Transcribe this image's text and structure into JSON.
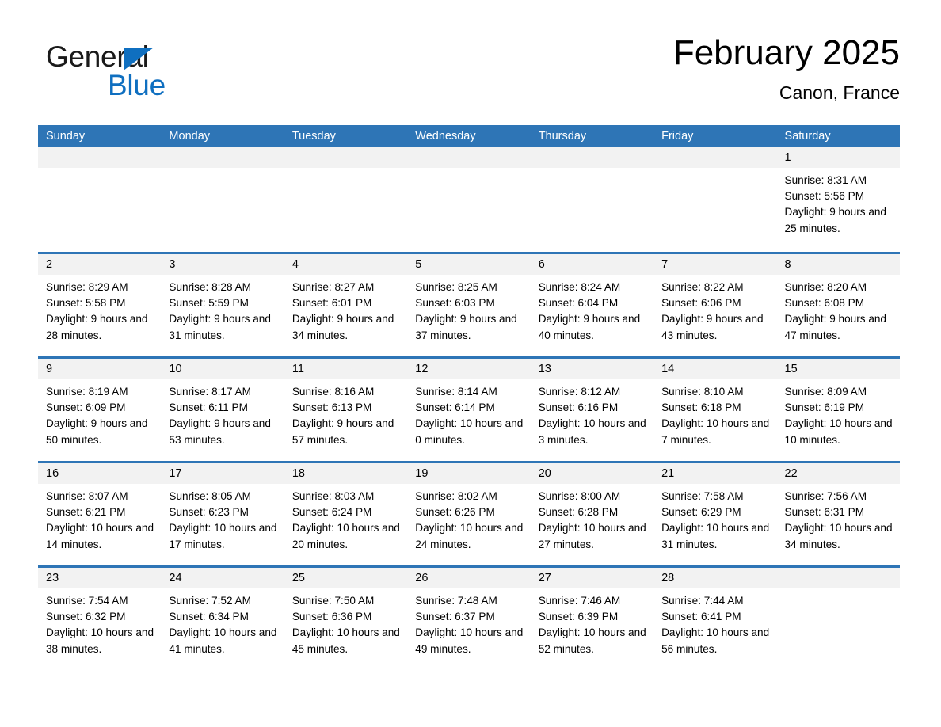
{
  "brand": {
    "name_part1": "General",
    "name_part2": "Blue",
    "triangle_color": "#0f6fc0"
  },
  "header": {
    "title": "February 2025",
    "location": "Canon, France"
  },
  "theme": {
    "header_blue": "#2e75b6",
    "day_band_gray": "#f2f2f2",
    "text_black": "#000000"
  },
  "weekdays": [
    "Sunday",
    "Monday",
    "Tuesday",
    "Wednesday",
    "Thursday",
    "Friday",
    "Saturday"
  ],
  "weeks": [
    [
      {
        "day": "",
        "empty": true
      },
      {
        "day": "",
        "empty": true
      },
      {
        "day": "",
        "empty": true
      },
      {
        "day": "",
        "empty": true
      },
      {
        "day": "",
        "empty": true
      },
      {
        "day": "",
        "empty": true
      },
      {
        "day": "1",
        "sunrise": "Sunrise: 8:31 AM",
        "sunset": "Sunset: 5:56 PM",
        "daylight": "Daylight: 9 hours and 25 minutes."
      }
    ],
    [
      {
        "day": "2",
        "sunrise": "Sunrise: 8:29 AM",
        "sunset": "Sunset: 5:58 PM",
        "daylight": "Daylight: 9 hours and 28 minutes."
      },
      {
        "day": "3",
        "sunrise": "Sunrise: 8:28 AM",
        "sunset": "Sunset: 5:59 PM",
        "daylight": "Daylight: 9 hours and 31 minutes."
      },
      {
        "day": "4",
        "sunrise": "Sunrise: 8:27 AM",
        "sunset": "Sunset: 6:01 PM",
        "daylight": "Daylight: 9 hours and 34 minutes."
      },
      {
        "day": "5",
        "sunrise": "Sunrise: 8:25 AM",
        "sunset": "Sunset: 6:03 PM",
        "daylight": "Daylight: 9 hours and 37 minutes."
      },
      {
        "day": "6",
        "sunrise": "Sunrise: 8:24 AM",
        "sunset": "Sunset: 6:04 PM",
        "daylight": "Daylight: 9 hours and 40 minutes."
      },
      {
        "day": "7",
        "sunrise": "Sunrise: 8:22 AM",
        "sunset": "Sunset: 6:06 PM",
        "daylight": "Daylight: 9 hours and 43 minutes."
      },
      {
        "day": "8",
        "sunrise": "Sunrise: 8:20 AM",
        "sunset": "Sunset: 6:08 PM",
        "daylight": "Daylight: 9 hours and 47 minutes."
      }
    ],
    [
      {
        "day": "9",
        "sunrise": "Sunrise: 8:19 AM",
        "sunset": "Sunset: 6:09 PM",
        "daylight": "Daylight: 9 hours and 50 minutes."
      },
      {
        "day": "10",
        "sunrise": "Sunrise: 8:17 AM",
        "sunset": "Sunset: 6:11 PM",
        "daylight": "Daylight: 9 hours and 53 minutes."
      },
      {
        "day": "11",
        "sunrise": "Sunrise: 8:16 AM",
        "sunset": "Sunset: 6:13 PM",
        "daylight": "Daylight: 9 hours and 57 minutes."
      },
      {
        "day": "12",
        "sunrise": "Sunrise: 8:14 AM",
        "sunset": "Sunset: 6:14 PM",
        "daylight": "Daylight: 10 hours and 0 minutes."
      },
      {
        "day": "13",
        "sunrise": "Sunrise: 8:12 AM",
        "sunset": "Sunset: 6:16 PM",
        "daylight": "Daylight: 10 hours and 3 minutes."
      },
      {
        "day": "14",
        "sunrise": "Sunrise: 8:10 AM",
        "sunset": "Sunset: 6:18 PM",
        "daylight": "Daylight: 10 hours and 7 minutes."
      },
      {
        "day": "15",
        "sunrise": "Sunrise: 8:09 AM",
        "sunset": "Sunset: 6:19 PM",
        "daylight": "Daylight: 10 hours and 10 minutes."
      }
    ],
    [
      {
        "day": "16",
        "sunrise": "Sunrise: 8:07 AM",
        "sunset": "Sunset: 6:21 PM",
        "daylight": "Daylight: 10 hours and 14 minutes."
      },
      {
        "day": "17",
        "sunrise": "Sunrise: 8:05 AM",
        "sunset": "Sunset: 6:23 PM",
        "daylight": "Daylight: 10 hours and 17 minutes."
      },
      {
        "day": "18",
        "sunrise": "Sunrise: 8:03 AM",
        "sunset": "Sunset: 6:24 PM",
        "daylight": "Daylight: 10 hours and 20 minutes."
      },
      {
        "day": "19",
        "sunrise": "Sunrise: 8:02 AM",
        "sunset": "Sunset: 6:26 PM",
        "daylight": "Daylight: 10 hours and 24 minutes."
      },
      {
        "day": "20",
        "sunrise": "Sunrise: 8:00 AM",
        "sunset": "Sunset: 6:28 PM",
        "daylight": "Daylight: 10 hours and 27 minutes."
      },
      {
        "day": "21",
        "sunrise": "Sunrise: 7:58 AM",
        "sunset": "Sunset: 6:29 PM",
        "daylight": "Daylight: 10 hours and 31 minutes."
      },
      {
        "day": "22",
        "sunrise": "Sunrise: 7:56 AM",
        "sunset": "Sunset: 6:31 PM",
        "daylight": "Daylight: 10 hours and 34 minutes."
      }
    ],
    [
      {
        "day": "23",
        "sunrise": "Sunrise: 7:54 AM",
        "sunset": "Sunset: 6:32 PM",
        "daylight": "Daylight: 10 hours and 38 minutes."
      },
      {
        "day": "24",
        "sunrise": "Sunrise: 7:52 AM",
        "sunset": "Sunset: 6:34 PM",
        "daylight": "Daylight: 10 hours and 41 minutes."
      },
      {
        "day": "25",
        "sunrise": "Sunrise: 7:50 AM",
        "sunset": "Sunset: 6:36 PM",
        "daylight": "Daylight: 10 hours and 45 minutes."
      },
      {
        "day": "26",
        "sunrise": "Sunrise: 7:48 AM",
        "sunset": "Sunset: 6:37 PM",
        "daylight": "Daylight: 10 hours and 49 minutes."
      },
      {
        "day": "27",
        "sunrise": "Sunrise: 7:46 AM",
        "sunset": "Sunset: 6:39 PM",
        "daylight": "Daylight: 10 hours and 52 minutes."
      },
      {
        "day": "28",
        "sunrise": "Sunrise: 7:44 AM",
        "sunset": "Sunset: 6:41 PM",
        "daylight": "Daylight: 10 hours and 56 minutes."
      },
      {
        "day": "",
        "empty": true
      }
    ]
  ]
}
